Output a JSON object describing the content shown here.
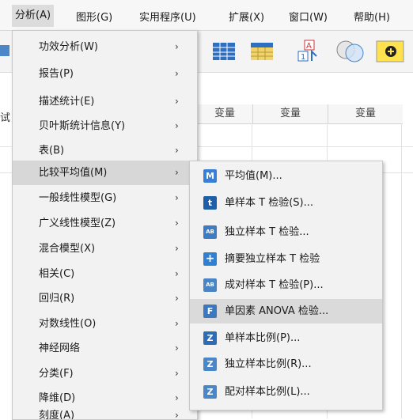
{
  "menubar": {
    "items": [
      {
        "label": "分析(A)"
      },
      {
        "label": "图形(G)"
      },
      {
        "label": "实用程序(U)"
      },
      {
        "label": "扩展(X)"
      },
      {
        "label": "窗口(W)"
      },
      {
        "label": "帮助(H)"
      }
    ]
  },
  "sheet": {
    "columns": [
      "变量",
      "变量",
      "变量"
    ],
    "left_fragment": "试"
  },
  "analyze_menu": {
    "items": [
      {
        "label": "功效分析(W)"
      },
      {
        "label": "报告(P)"
      },
      {
        "label": "描述统计(E)"
      },
      {
        "label": "贝叶斯统计信息(Y)"
      },
      {
        "label": "表(B)"
      },
      {
        "label": "比较平均值(M)"
      },
      {
        "label": "一般线性模型(G)"
      },
      {
        "label": "广义线性模型(Z)"
      },
      {
        "label": "混合模型(X)"
      },
      {
        "label": "相关(C)"
      },
      {
        "label": "回归(R)"
      },
      {
        "label": "对数线性(O)"
      },
      {
        "label": "神经网络"
      },
      {
        "label": "分类(F)"
      },
      {
        "label": "降维(D)"
      },
      {
        "label": "刻度(A)"
      }
    ],
    "arrow": "›"
  },
  "compare_means_menu": {
    "items": [
      {
        "label": "平均值(M)...",
        "icon": "means-icon",
        "glyph": "M",
        "color": "#3a7fd5"
      },
      {
        "label": "单样本 T 检验(S)...",
        "icon": "one-sample-t-icon",
        "glyph": "t",
        "color": "#1f5fa8"
      },
      {
        "label": "独立样本 T 检验...",
        "icon": "independent-t-icon",
        "glyph": "AB",
        "color": "#3d7cc2"
      },
      {
        "label": "摘要独立样本 T 检验",
        "icon": "summary-t-icon",
        "glyph": "+",
        "color": "#2f80d0"
      },
      {
        "label": "成对样本 T 检验(P)...",
        "icon": "paired-t-icon",
        "glyph": "AB",
        "color": "#4a84c4"
      },
      {
        "label": "单因素 ANOVA 检验...",
        "icon": "anova-icon",
        "glyph": "F",
        "color": "#3a78c0"
      },
      {
        "label": "单样本比例(P)...",
        "icon": "one-sample-proportion-icon",
        "glyph": "Z",
        "color": "#2d6cb8"
      },
      {
        "label": "独立样本比例(R)...",
        "icon": "independent-proportion-icon",
        "glyph": "Z",
        "color": "#4a87c8"
      },
      {
        "label": "配对样本比例(L)...",
        "icon": "paired-proportion-icon",
        "glyph": "Z",
        "color": "#4a87c8"
      }
    ]
  },
  "colors": {
    "menu_bg": "#f2f2f2",
    "highlight": "#d7d7d7"
  }
}
